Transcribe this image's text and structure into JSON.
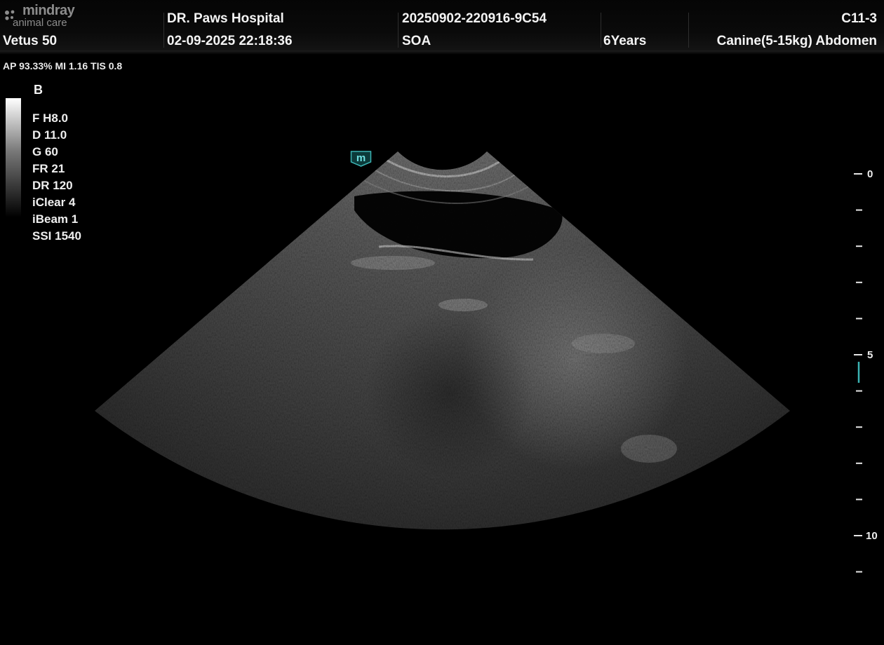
{
  "header": {
    "brand": "mindray",
    "brand_sub": "animal care",
    "device": "Vetus 50",
    "hospital": "DR. Paws Hospital",
    "datetime": "02-09-2025  22:18:36",
    "exam_id": "20250902-220916-9C54",
    "operator": "SOA",
    "age": "6Years",
    "probe": "C11-3",
    "preset": "Canine(5-15kg) Abdomen"
  },
  "safety": {
    "text": "AP 93.33%  MI 1.16 TIS 0.8"
  },
  "imaging": {
    "mode": "B",
    "params": [
      "F H8.0",
      "D 11.0",
      "G 60",
      "FR 21",
      "DR 120",
      "iClear 4",
      "iBeam 1",
      "SSI 1540"
    ]
  },
  "depth_scale": {
    "labels": [
      "0",
      "5",
      "10"
    ],
    "unit_steps": 11,
    "focus_depth_cm": 5.2
  },
  "colors": {
    "background": "#000000",
    "text": "#f2f2f2",
    "brand_gray": "#8c8c8c",
    "marker": "#3bb3b3"
  },
  "icons": [
    "mindray-logo-icon",
    "m-orientation-marker-icon"
  ]
}
